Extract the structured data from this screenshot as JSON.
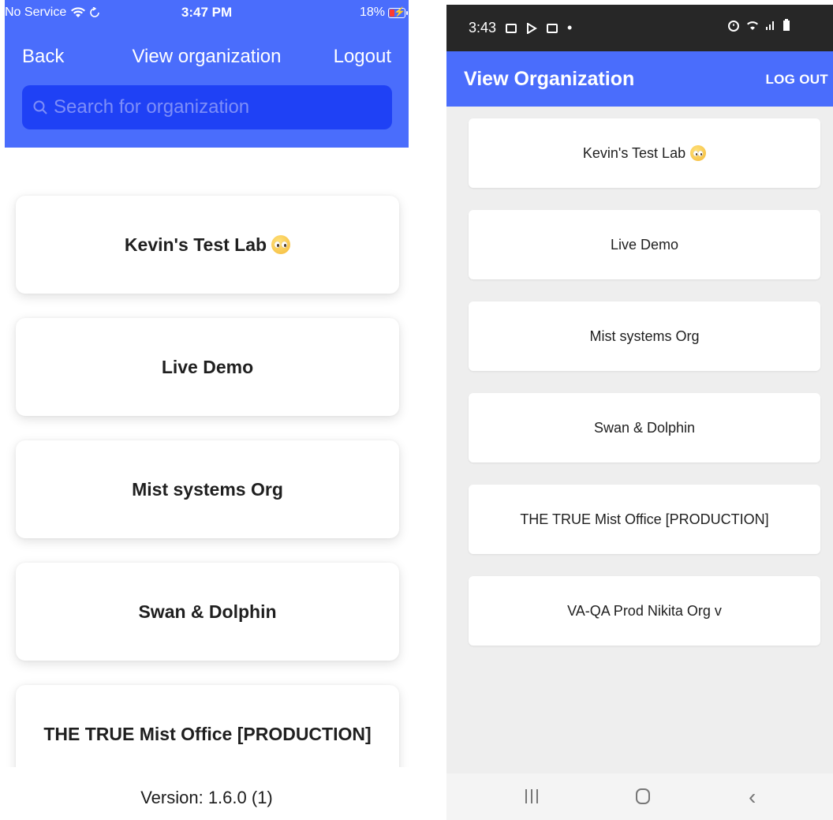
{
  "ios": {
    "status": {
      "carrier": "No Service",
      "time": "3:47 PM",
      "battery": "18%"
    },
    "nav": {
      "back_label": "Back",
      "title": "View organization",
      "logout_label": "Logout"
    },
    "search": {
      "placeholder": "Search for organization",
      "value": ""
    },
    "organizations": [
      {
        "name": "Kevin's Test Lab",
        "emoji": "pleading-face"
      },
      {
        "name": "Live Demo"
      },
      {
        "name": "Mist systems Org"
      },
      {
        "name": "Swan & Dolphin"
      },
      {
        "name": "THE TRUE Mist Office [PRODUCTION]"
      }
    ],
    "version": "Version: 1.6.0 (1)"
  },
  "android": {
    "status": {
      "time": "3:43"
    },
    "appbar": {
      "title": "View Organization",
      "logout_label": "LOG OUT"
    },
    "organizations": [
      {
        "name": "Kevin's Test Lab",
        "emoji": "pleading-face"
      },
      {
        "name": "Live Demo"
      },
      {
        "name": "Mist systems Org"
      },
      {
        "name": "Swan & Dolphin"
      },
      {
        "name": "THE TRUE Mist Office [PRODUCTION]"
      },
      {
        "name": "VA-QA Prod Nikita Org v"
      }
    ]
  },
  "colors": {
    "brand_blue": "#4a6dfc",
    "search_field_blue": "#1f41f5",
    "android_status_bar": "#272727",
    "android_background": "#eeeeee"
  }
}
